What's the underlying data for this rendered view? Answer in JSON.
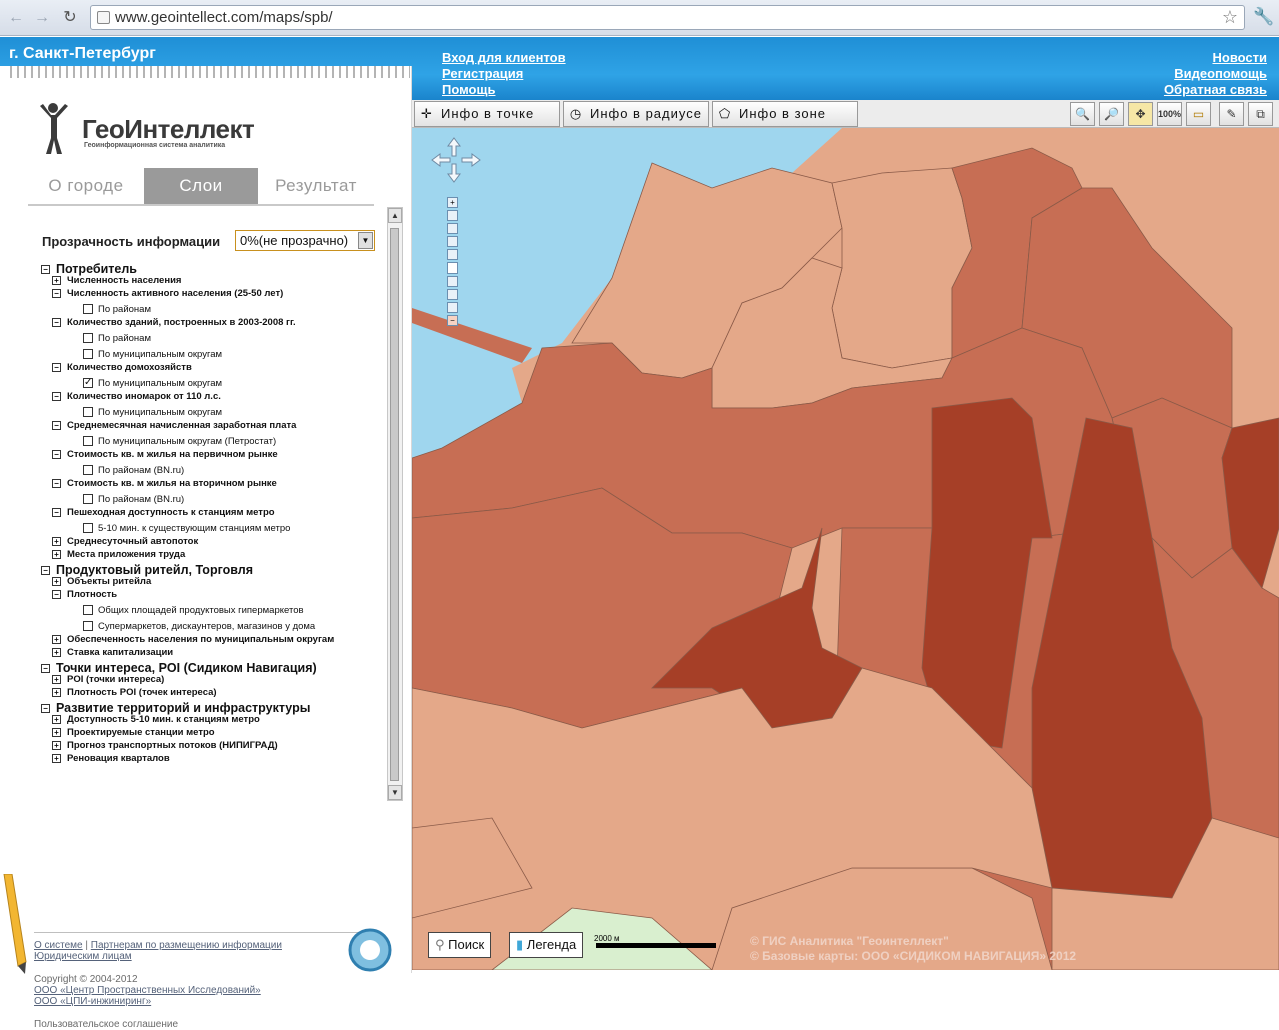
{
  "browser": {
    "url": "www.geointellect.com/maps/spb/"
  },
  "header": {
    "city": "г. Санкт-Петербург",
    "links_left": [
      "Вход для клиентов",
      "Регистрация",
      "Помощь"
    ],
    "links_right": [
      "Новости",
      "Видеопомощь",
      "Обратная связь"
    ]
  },
  "logo": {
    "title": "ГеоИнтеллект",
    "subtitle": "Геоинформационная система аналитика"
  },
  "tabs": [
    "О городе",
    "Слои",
    "Результат"
  ],
  "active_tab": "Слои",
  "transparency": {
    "label": "Прозрачность информации",
    "value": "0%(не прозрачно)"
  },
  "tree": [
    {
      "level": 0,
      "toggle": "minus",
      "label": "Потребитель"
    },
    {
      "level": 1,
      "toggle": "plus",
      "label": "Численность населения"
    },
    {
      "level": 1,
      "toggle": "minus",
      "label": "Численность активного населения (25-50 лет)"
    },
    {
      "level": 2,
      "checked": false,
      "label": "По районам"
    },
    {
      "level": 1,
      "toggle": "minus",
      "label": "Количество зданий, построенных в 2003-2008 гг."
    },
    {
      "level": 2,
      "checked": false,
      "label": "По районам"
    },
    {
      "level": 2,
      "checked": false,
      "label": "По муниципальным округам"
    },
    {
      "level": 1,
      "toggle": "minus",
      "label": "Количество домохозяйств"
    },
    {
      "level": 2,
      "checked": true,
      "label": "По муниципальным округам"
    },
    {
      "level": 1,
      "toggle": "minus",
      "label": "Количество иномарок от 110 л.с."
    },
    {
      "level": 2,
      "checked": false,
      "label": "По муниципальным округам"
    },
    {
      "level": 1,
      "toggle": "minus",
      "label": "Среднемесячная начисленная заработная плата"
    },
    {
      "level": 2,
      "checked": false,
      "label": "По муниципальным округам (Петростат)"
    },
    {
      "level": 1,
      "toggle": "minus",
      "label": "Стоимость кв. м жилья на первичном рынке"
    },
    {
      "level": 2,
      "checked": false,
      "label": "По районам (BN.ru)"
    },
    {
      "level": 1,
      "toggle": "minus",
      "label": "Стоимость кв. м жилья на вторичном рынке"
    },
    {
      "level": 2,
      "checked": false,
      "label": "По районам (BN.ru)"
    },
    {
      "level": 1,
      "toggle": "minus",
      "label": "Пешеходная доступность к станциям метро"
    },
    {
      "level": 2,
      "checked": false,
      "label": "5-10 мин. к существующим станциям метро"
    },
    {
      "level": 1,
      "toggle": "plus",
      "label": "Среднесуточный автопоток"
    },
    {
      "level": 1,
      "toggle": "plus",
      "label": "Места приложения труда"
    },
    {
      "level": 0,
      "toggle": "minus",
      "label": "Продуктовый ритейл, Торговля"
    },
    {
      "level": 1,
      "toggle": "plus",
      "label": "Объекты ритейла"
    },
    {
      "level": 1,
      "toggle": "minus",
      "label": "Плотность"
    },
    {
      "level": 2,
      "checked": false,
      "label": "Общих площадей продуктовых гипермаркетов"
    },
    {
      "level": 2,
      "checked": false,
      "label": "Супермаркетов, дискаунтеров, магазинов у дома"
    },
    {
      "level": 1,
      "toggle": "plus",
      "label": "Обеспеченность населения по муниципальным округам"
    },
    {
      "level": 1,
      "toggle": "plus",
      "label": "Ставка капитализации"
    },
    {
      "level": 0,
      "toggle": "minus",
      "label": "Точки интереса, POI (Сидиком Навигация)"
    },
    {
      "level": 1,
      "toggle": "plus",
      "label": "POI (точки интереса)"
    },
    {
      "level": 1,
      "toggle": "plus",
      "label": "Плотность POI (точек интереса)"
    },
    {
      "level": 0,
      "toggle": "minus",
      "label": "Развитие территорий и инфраструктуры"
    },
    {
      "level": 1,
      "toggle": "plus",
      "label": "Доступность 5-10 мин. к станциям метро"
    },
    {
      "level": 1,
      "toggle": "plus",
      "label": "Проектируемые станции метро"
    },
    {
      "level": 1,
      "toggle": "plus",
      "label": "Прогноз транспортных потоков (НИПИГРАД)"
    },
    {
      "level": 1,
      "toggle": "plus",
      "label": "Реновация кварталов"
    }
  ],
  "footer": {
    "about": "О системе",
    "partners": "Партнерам по размещению информации",
    "legal": "Юридическим лицам",
    "copyright": "Copyright © 2004-2012",
    "org1": "ООО «Центр Пространственных Исследований»",
    "org2": "ООО «ЦПИ-инжиниринг»",
    "agreement": "Пользовательское соглашение"
  },
  "toolbar": {
    "info_point": "Инфо в точке",
    "info_radius": "Инфо в радиусе",
    "info_zone": "Инфо в зоне",
    "zoom100": "100%"
  },
  "map": {
    "search": "Поиск",
    "legend": "Легенда",
    "scale": "2000 м",
    "copyright1": "© ГИС Аналитика \"Геоинтеллект\"",
    "copyright2": "© Базовые карты: ООО «СИДИКОМ НАВИГАЦИЯ» 2012",
    "colors": {
      "water": "#9fd6ee",
      "light": "#e4a889",
      "medium": "#c76e54",
      "dark": "#a63f27",
      "park": "#d9efcf"
    }
  }
}
